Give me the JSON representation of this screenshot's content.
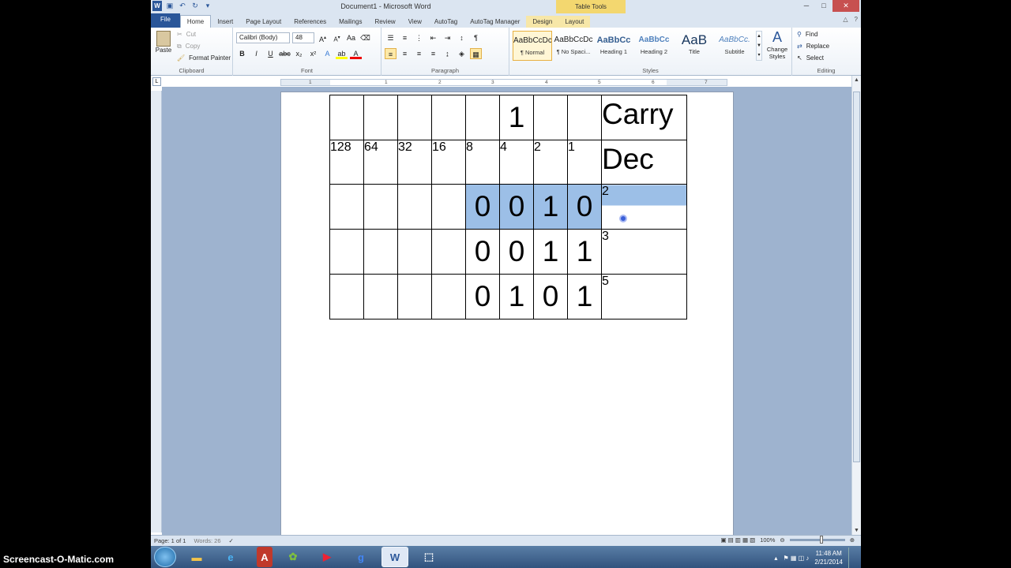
{
  "window": {
    "title": "Document1 - Microsoft Word",
    "context_tab_group": "Table Tools"
  },
  "tabs": [
    "File",
    "Home",
    "Insert",
    "Page Layout",
    "References",
    "Mailings",
    "Review",
    "View",
    "AutoTag",
    "AutoTag Manager",
    "Design",
    "Layout"
  ],
  "clipboard": {
    "paste": "Paste",
    "cut": "Cut",
    "copy": "Copy",
    "format_painter": "Format Painter",
    "group": "Clipboard"
  },
  "font": {
    "name": "Calibri (Body)",
    "size": "48",
    "group": "Font"
  },
  "paragraph": {
    "group": "Paragraph"
  },
  "styles": {
    "group": "Styles",
    "items": [
      {
        "preview": "AaBbCcDc",
        "label": "¶ Normal"
      },
      {
        "preview": "AaBbCcDc",
        "label": "¶ No Spaci..."
      },
      {
        "preview": "AaBbCc",
        "label": "Heading 1"
      },
      {
        "preview": "AaBbCc",
        "label": "Heading 2"
      },
      {
        "preview": "AaB",
        "label": "Title"
      },
      {
        "preview": "AaBbCc.",
        "label": "Subtitle"
      }
    ],
    "change_styles": "Change Styles"
  },
  "editing": {
    "find": "Find",
    "replace": "Replace",
    "select": "Select",
    "group": "Editing"
  },
  "ruler_numbers": [
    "1",
    "1",
    "2",
    "3",
    "4",
    "5",
    "6",
    "7"
  ],
  "table": {
    "rows": [
      [
        "",
        "",
        "",
        "",
        "",
        "1",
        "",
        "",
        "Carry"
      ],
      [
        "128",
        "64",
        "32",
        "16",
        "8",
        "4",
        "2",
        "1",
        "Dec"
      ],
      [
        "",
        "",
        "",
        "",
        "0",
        "0",
        "1",
        "0",
        "2"
      ],
      [
        "",
        "",
        "",
        "",
        "0",
        "0",
        "1",
        "1",
        "3"
      ],
      [
        "",
        "",
        "",
        "",
        "0",
        "1",
        "0",
        "1",
        "5"
      ]
    ]
  },
  "status": {
    "page": "Page: 1 of 1",
    "words": "Words: 26",
    "zoom": "100%"
  },
  "watermark": "Screencast-O-Matic.com",
  "taskbar": {
    "time": "11:48 AM",
    "date": "2/21/2014",
    "apps": [
      "folder",
      "ie",
      "acrobat",
      "green-app",
      "youtube",
      "google",
      "word",
      "snipping"
    ]
  },
  "colors": {
    "selection": "#9cbfe7",
    "file_tab": "#2a5699",
    "table_tools": "#f3d76f"
  }
}
